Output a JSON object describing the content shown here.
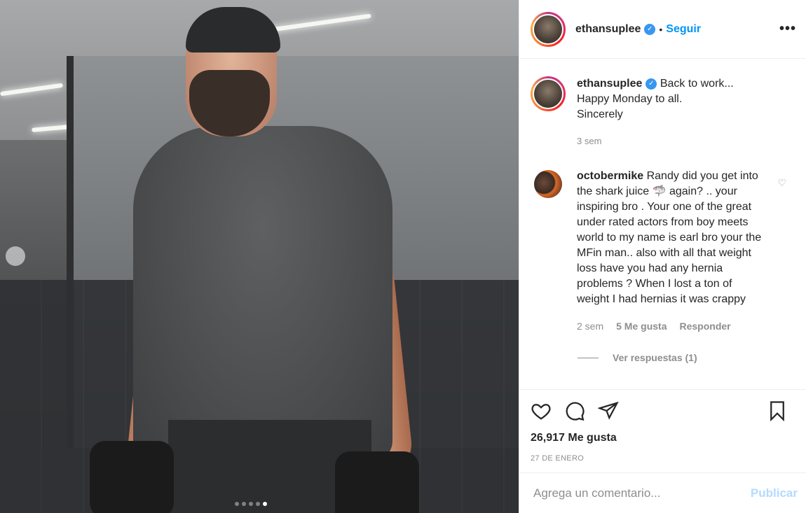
{
  "post": {
    "username": "ethansuplee",
    "follow_label": "Seguir",
    "separator": "•",
    "more_label": "•••",
    "caption_lines": [
      "Back to work...",
      "Happy Monday to all.",
      "Sincerely"
    ],
    "caption_time": "3 sem"
  },
  "comment": {
    "username": "octobermike",
    "text": "Randy did you get into the shark juice 🦈 again? .. your inspiring bro . Your one of the great under rated actors from boy meets world to my name is earl bro your the MFin man.. also with all that weight loss have you had any hernia problems ? When I lost a ton of weight I had hernias it was crappy",
    "time": "2 sem",
    "likes": "5 Me gusta",
    "reply_label": "Responder",
    "view_replies": "Ver respuestas (1)"
  },
  "actions": {
    "likes_count": "26,917 Me gusta",
    "date": "27 DE ENERO"
  },
  "add_comment": {
    "placeholder": "Agrega un comentario...",
    "publish_label": "Publicar"
  },
  "carousel": {
    "total": 5,
    "active_index": 4
  },
  "colors": {
    "link": "#0095f6",
    "verified": "#3897f0",
    "muted": "#8e8e8e"
  }
}
